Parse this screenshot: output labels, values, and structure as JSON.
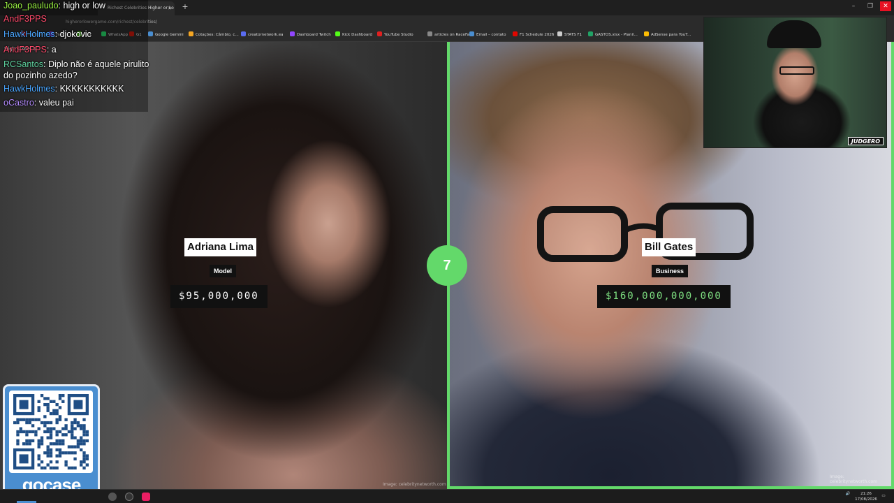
{
  "browser": {
    "tab_title": "Richest Celebrities Higher or Lo",
    "url": "higherorlowergame.com/richest/celebrities/",
    "bookmarks": [
      {
        "label": "YouTube",
        "color": "#e02020"
      },
      {
        "label": "Twitch",
        "color": "#9146ff"
      },
      {
        "label": "Kick",
        "color": "#53fc18"
      },
      {
        "label": "WhatsApp",
        "color": "#25d366"
      },
      {
        "label": "G1",
        "color": "#c4170c"
      },
      {
        "label": "Google Gemini",
        "color": "#4a8ed0"
      },
      {
        "label": "Cotações: Câmbio, c...",
        "color": "#f5a623"
      },
      {
        "label": "creatornetwork.ea",
        "color": "#5a6cf0"
      },
      {
        "label": "Dashboard Twitch",
        "color": "#9146ff"
      },
      {
        "label": "Kick Dashboard",
        "color": "#53fc18"
      },
      {
        "label": "YouTube Studio",
        "color": "#e02020"
      },
      {
        "label": "articles on RaceFans",
        "color": "#888888"
      },
      {
        "label": "Email – contato",
        "color": "#4a8ed0"
      },
      {
        "label": "F1 Schedule 2026",
        "color": "#e10600"
      },
      {
        "label": "STATS F1",
        "color": "#cccccc"
      },
      {
        "label": "GASTOS.xlsx - Planil...",
        "color": "#21a366"
      },
      {
        "label": "AdSense para YouT...",
        "color": "#fbbc04"
      }
    ]
  },
  "chat": [
    {
      "user": "Joao_pauludo",
      "color": "#9bf542",
      "text": "high or low"
    },
    {
      "user": "AndF3PPS",
      "color": "#ff4a6b",
      "text": ""
    },
    {
      "user": "HawkHolmes",
      "color": "#4aa6ff",
      "text": "djokovic"
    },
    {
      "user": "AndF3PPS",
      "color": "#ff4a6b",
      "text": "a"
    },
    {
      "user": "RCSantos",
      "color": "#5fd3a0",
      "text": "Diplo não é aquele pirulito"
    },
    {
      "user": "",
      "color": "#ffffff",
      "text": "do pozinho azedo?"
    },
    {
      "user": "HawkHolmes",
      "color": "#4aa6ff",
      "text": "KKKKKKKKKKK"
    },
    {
      "user": "oCastro",
      "color": "#b48cff",
      "text": "valeu pai"
    }
  ],
  "game": {
    "high_score_label": "High score: 1",
    "score": "7",
    "left": {
      "name": "Adriana Lima",
      "category": "Model",
      "value": "$95,000,000",
      "credit": "Image: celebritynetworth.com"
    },
    "right": {
      "name": "Bill Gates",
      "category": "Business",
      "value": "$160,000,000,000",
      "credit": "Image: celebritynetworth.com"
    }
  },
  "webcam": {
    "logo": "JUDGERO"
  },
  "qr": {
    "brand": "gocase"
  },
  "taskbar": {
    "time": "21:26",
    "date": "17/08/2026"
  },
  "colors": {
    "accent_green": "#63d96a",
    "value_green": "#7ee081",
    "qr_blue": "#4a8ed0"
  }
}
